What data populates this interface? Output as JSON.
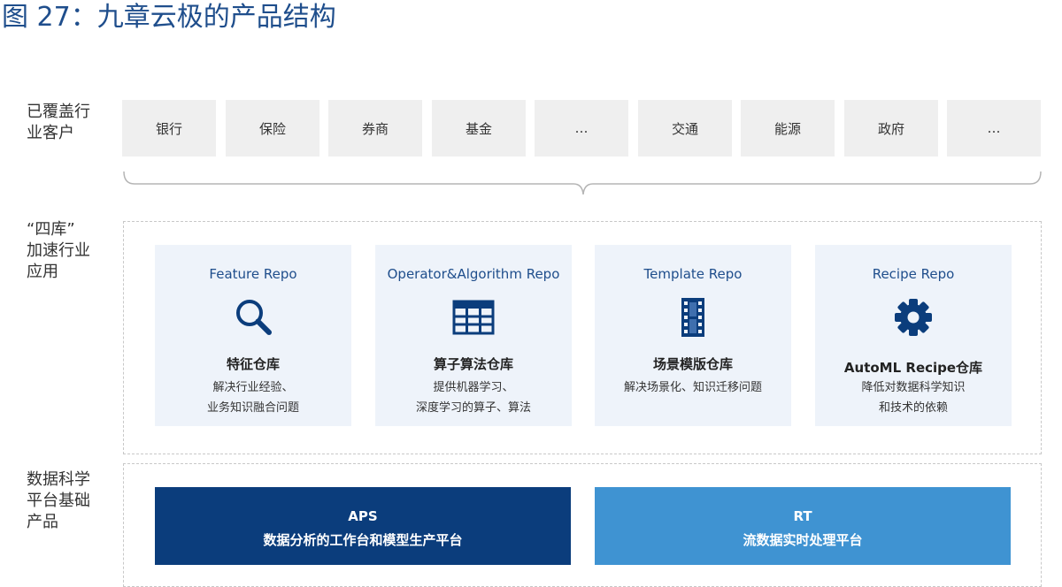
{
  "title": "图 27：九章云极的产品结构",
  "rows": {
    "customers_label": [
      "已覆盖行",
      "业客户"
    ],
    "apps_label": [
      "“四库”",
      "加速行业",
      "应用"
    ],
    "platform_label": [
      "数据科学",
      "平台基础",
      "产品"
    ]
  },
  "customers": [
    "银行",
    "保险",
    "券商",
    "基金",
    "…",
    "交通",
    "能源",
    "政府",
    "…"
  ],
  "repos": [
    {
      "title": "Feature Repo",
      "icon": "search-icon",
      "name": "特征仓库",
      "desc": [
        "解决行业经验、",
        "业务知识融合问题"
      ]
    },
    {
      "title": "Operator&Algorithm Repo",
      "icon": "grid-icon",
      "name": "算子算法仓库",
      "desc": [
        "提供机器学习、",
        "深度学习的算子、算法"
      ]
    },
    {
      "title": "Template Repo",
      "icon": "film-icon",
      "name": "场景模版仓库",
      "desc": [
        "解决场景化、知识迁移问题"
      ]
    },
    {
      "title": "Recipe Repo",
      "icon": "gear-icon",
      "name": "AutoML Recipe仓库",
      "desc": [
        "降低对数据科学知识",
        "和技术的依赖"
      ]
    }
  ],
  "platforms": [
    {
      "name": "APS",
      "desc": "数据分析的工作台和模型生产平台",
      "color": "#0b3d7c"
    },
    {
      "name": "RT",
      "desc": "流数据实时处理平台",
      "color": "#3f93d2"
    }
  ],
  "colors": {
    "accent": "#1f4e8c",
    "repo_bg": "#eef3fa",
    "customer_bg": "#efefef"
  }
}
